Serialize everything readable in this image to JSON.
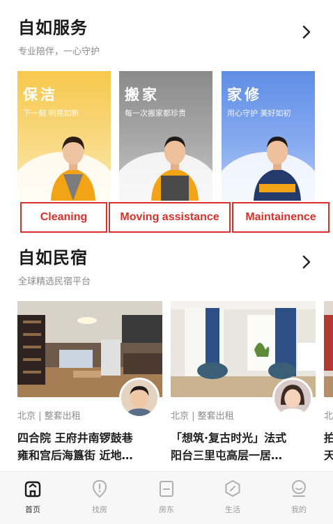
{
  "services": {
    "title": "自如服务",
    "subtitle": "专业陪伴，一心守护",
    "cards": [
      {
        "title": "保洁",
        "subtitle": "下一刻 明亮如新"
      },
      {
        "title": "搬家",
        "subtitle": "每一次搬家都珍贵"
      },
      {
        "title": "家修",
        "subtitle": "用心守护 美好如初"
      }
    ],
    "annotations": [
      "Cleaning",
      "Moving assistance",
      "Maintainence"
    ]
  },
  "homestay": {
    "title": "自如民宿",
    "subtitle": "全球精选民宿平台",
    "listings": [
      {
        "location": "北京 | 整套出租",
        "title_line1": "四合院 王府井南锣鼓巷",
        "title_line2": "雍和宫后海簋街 近地…"
      },
      {
        "location": "北京 | 整套出租",
        "title_line1": "「想筑·复古时光」法式",
        "title_line2": "阳台三里屯高层一居…"
      },
      {
        "location": "北",
        "title_line1": "拍",
        "title_line2": "天"
      }
    ]
  },
  "tabbar": {
    "tabs": [
      {
        "label": "首页",
        "icon": "home-icon",
        "active": true
      },
      {
        "label": "找房",
        "icon": "find-house-icon",
        "active": false
      },
      {
        "label": "房东",
        "icon": "landlord-icon",
        "active": false
      },
      {
        "label": "生活",
        "icon": "life-icon",
        "active": false
      },
      {
        "label": "我的",
        "icon": "profile-icon",
        "active": false
      }
    ]
  },
  "colors": {
    "cleaning": "#f6c94c",
    "moving": "#8a8a8a",
    "repair": "#5f8ee6",
    "annotation": "#d9312a"
  }
}
